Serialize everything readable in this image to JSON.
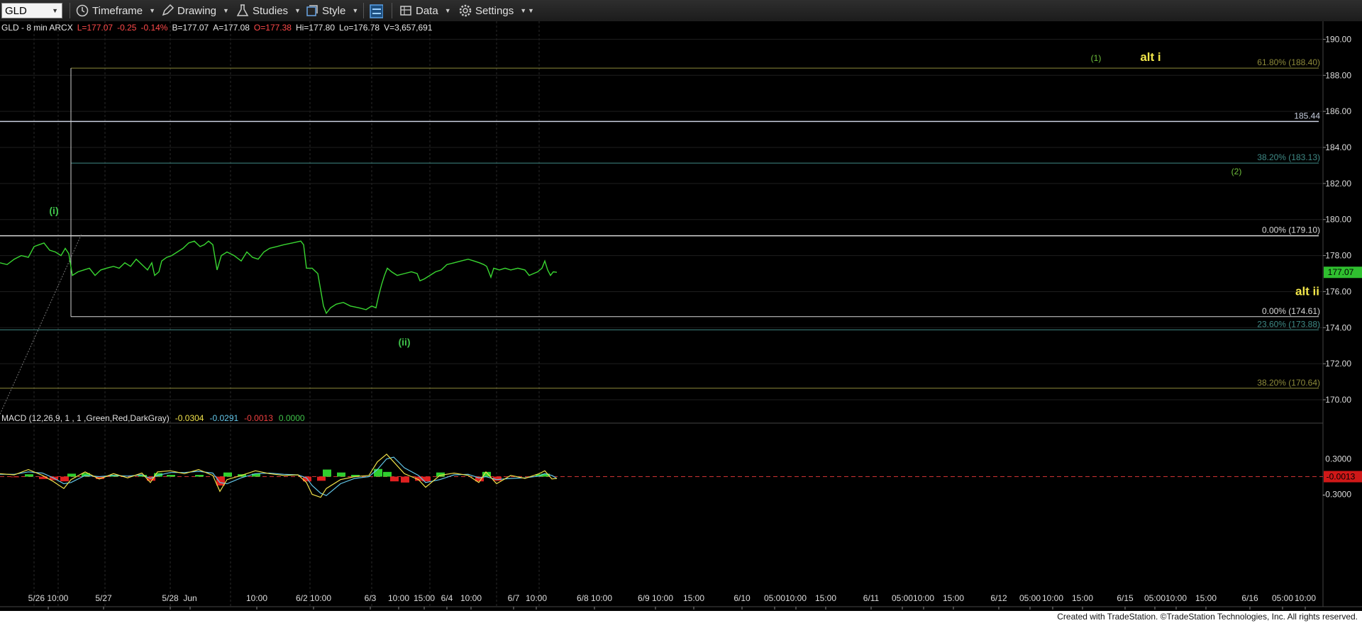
{
  "toolbar": {
    "symbol": "GLD",
    "items": [
      {
        "label": "Timeframe",
        "icon": "clock-icon"
      },
      {
        "label": "Drawing",
        "icon": "pencil-icon"
      },
      {
        "label": "Studies",
        "icon": "flask-icon"
      },
      {
        "label": "Style",
        "icon": "style-icon"
      },
      {
        "label": "",
        "icon": "layout-icon"
      },
      {
        "label": "Data",
        "icon": "data-table-icon"
      },
      {
        "label": "Settings",
        "icon": "gear-icon"
      }
    ]
  },
  "header": {
    "symbol_info": "GLD - 8 min  ARCX",
    "last": "L=177.07",
    "change": "-0.25",
    "pct_change": "-0.14%",
    "bid": "B=177.07",
    "ask": "A=177.08",
    "open": "O=177.38",
    "high": "Hi=177.80",
    "low": "Lo=176.78",
    "volume": "V=3,657,691"
  },
  "chart_data": {
    "type": "line",
    "price_axis": {
      "ticks": [
        "190.00",
        "188.00",
        "186.00",
        "184.00",
        "182.00",
        "180.00",
        "178.00",
        "176.00",
        "174.00",
        "172.00",
        "170.00"
      ],
      "range": [
        168.9,
        191.0
      ]
    },
    "last_price_tag": "177.07",
    "horizontal_levels": [
      {
        "price": 188.4,
        "label": "61.80% (188.40)",
        "color": "#8d8a3a"
      },
      {
        "price": 185.44,
        "label": "185.44",
        "color": "#c9d0e0"
      },
      {
        "price": 183.13,
        "label": "38.20% (183.13)",
        "color": "#3f8a86"
      },
      {
        "price": 179.1,
        "label": "0.00% (179.10)",
        "color": "#d8d8d8"
      },
      {
        "price": 174.61,
        "label": "0.00% (174.61)",
        "color": "#d8d8d8"
      },
      {
        "price": 173.88,
        "label": "23.60% (173.88)",
        "color": "#3f8a86"
      },
      {
        "price": 170.64,
        "label": "38.20% (170.64)",
        "color": "#8d8a3a"
      }
    ],
    "wave_labels": [
      {
        "text": "(i)",
        "color": "#3fc24a"
      },
      {
        "text": "(ii)",
        "color": "#3fc24a"
      },
      {
        "text": "(1)",
        "color": "#6fc03c"
      },
      {
        "text": "(2)",
        "color": "#6fc03c"
      },
      {
        "text": "alt i",
        "color": "#f2e64a"
      },
      {
        "text": "alt ii",
        "color": "#f2e64a"
      }
    ],
    "time_axis": [
      "5/26 10:00",
      "5/27",
      "5/28",
      "Jun",
      "10:00",
      "6/2 10:00",
      "6/3",
      "10:00",
      "15:00",
      "6/4",
      "10:00",
      "6/7",
      "10:00",
      "6/8 10:00",
      "6/9 10:00",
      "15:00",
      "6/10",
      "05:00",
      "10:00",
      "15:00",
      "6/11",
      "05:00",
      "10:00",
      "15:00",
      "6/12",
      "05:00",
      "10:00",
      "15:00",
      "6/15",
      "05:00",
      "10:00",
      "15:00",
      "6/16",
      "05:00",
      "10:00"
    ],
    "price_series": [
      [
        0,
        177.6
      ],
      [
        10,
        177.5
      ],
      [
        20,
        177.8
      ],
      [
        30,
        178.0
      ],
      [
        40,
        177.9
      ],
      [
        48,
        178.5
      ],
      [
        55,
        178.6
      ],
      [
        62,
        178.7
      ],
      [
        70,
        178.3
      ],
      [
        78,
        178.2
      ],
      [
        86,
        178.0
      ],
      [
        92,
        178.4
      ],
      [
        97,
        178.1
      ],
      [
        102,
        176.9
      ],
      [
        110,
        177.1
      ],
      [
        118,
        177.2
      ],
      [
        126,
        177.3
      ],
      [
        134,
        176.9
      ],
      [
        142,
        177.2
      ],
      [
        150,
        177.3
      ],
      [
        160,
        177.4
      ],
      [
        168,
        177.3
      ],
      [
        176,
        177.6
      ],
      [
        184,
        177.4
      ],
      [
        192,
        177.8
      ],
      [
        200,
        177.5
      ],
      [
        208,
        177.2
      ],
      [
        214,
        177.6
      ],
      [
        218,
        176.9
      ],
      [
        224,
        177.1
      ],
      [
        228,
        177.7
      ],
      [
        235,
        177.9
      ],
      [
        242,
        178.0
      ],
      [
        250,
        178.2
      ],
      [
        258,
        178.4
      ],
      [
        266,
        178.7
      ],
      [
        274,
        178.8
      ],
      [
        282,
        178.5
      ],
      [
        288,
        178.6
      ],
      [
        294,
        178.8
      ],
      [
        300,
        178.6
      ],
      [
        306,
        177.2
      ],
      [
        312,
        178.0
      ],
      [
        320,
        178.2
      ],
      [
        330,
        178.0
      ],
      [
        340,
        177.7
      ],
      [
        348,
        178.2
      ],
      [
        356,
        177.9
      ],
      [
        364,
        177.8
      ],
      [
        372,
        178.2
      ],
      [
        380,
        178.4
      ],
      [
        390,
        178.5
      ],
      [
        400,
        178.6
      ],
      [
        412,
        178.7
      ],
      [
        424,
        178.8
      ],
      [
        428,
        178.6
      ],
      [
        432,
        177.3
      ],
      [
        440,
        177.3
      ],
      [
        448,
        177.0
      ],
      [
        452,
        176.1
      ],
      [
        456,
        175.2
      ],
      [
        460,
        174.8
      ],
      [
        466,
        175.1
      ],
      [
        474,
        175.3
      ],
      [
        484,
        175.4
      ],
      [
        494,
        175.2
      ],
      [
        506,
        175.1
      ],
      [
        516,
        175.0
      ],
      [
        524,
        175.2
      ],
      [
        530,
        175.1
      ],
      [
        534,
        175.8
      ],
      [
        538,
        176.4
      ],
      [
        542,
        176.9
      ],
      [
        546,
        177.3
      ],
      [
        552,
        177.1
      ],
      [
        560,
        176.9
      ],
      [
        570,
        177.0
      ],
      [
        580,
        177.1
      ],
      [
        588,
        177.0
      ],
      [
        592,
        176.6
      ],
      [
        598,
        176.7
      ],
      [
        606,
        176.9
      ],
      [
        614,
        177.1
      ],
      [
        622,
        177.2
      ],
      [
        630,
        177.5
      ],
      [
        640,
        177.6
      ],
      [
        650,
        177.7
      ],
      [
        660,
        177.8
      ],
      [
        668,
        177.7
      ],
      [
        676,
        177.6
      ],
      [
        682,
        177.5
      ],
      [
        686,
        177.4
      ],
      [
        692,
        176.8
      ],
      [
        696,
        177.3
      ],
      [
        704,
        177.2
      ],
      [
        712,
        177.3
      ],
      [
        720,
        177.2
      ],
      [
        730,
        177.3
      ],
      [
        740,
        177.2
      ],
      [
        746,
        176.9
      ],
      [
        752,
        177.0
      ],
      [
        758,
        177.1
      ],
      [
        764,
        177.3
      ],
      [
        768,
        177.7
      ],
      [
        772,
        177.2
      ],
      [
        776,
        176.9
      ],
      [
        780,
        177.1
      ],
      [
        785,
        177.07
      ]
    ],
    "macd": {
      "label": "MACD (12,26,9, 1 , 1 ,Green,Red,DarkGray)",
      "values": [
        "-0.0304",
        "-0.0291",
        "-0.0013",
        "0.0000"
      ],
      "value_colors": [
        "#f0e14a",
        "#63c7ea",
        "#f04040",
        "#3fc24a"
      ],
      "axis_ticks": [
        "0.3000",
        "-0.3000"
      ],
      "last_tag": "-0.0013",
      "range": [
        -0.45,
        0.45
      ],
      "macd_line": [
        [
          0,
          0.05
        ],
        [
          20,
          0.03
        ],
        [
          40,
          0.12
        ],
        [
          60,
          0.02
        ],
        [
          75,
          -0.08
        ],
        [
          90,
          -0.2
        ],
        [
          100,
          -0.05
        ],
        [
          120,
          0.08
        ],
        [
          140,
          -0.04
        ],
        [
          160,
          0.05
        ],
        [
          180,
          -0.02
        ],
        [
          200,
          0.06
        ],
        [
          212,
          -0.1
        ],
        [
          222,
          0.08
        ],
        [
          240,
          0.1
        ],
        [
          260,
          0.05
        ],
        [
          280,
          0.12
        ],
        [
          300,
          0.02
        ],
        [
          310,
          -0.25
        ],
        [
          320,
          -0.05
        ],
        [
          340,
          0.02
        ],
        [
          360,
          0.1
        ],
        [
          380,
          0.05
        ],
        [
          400,
          0.02
        ],
        [
          420,
          0.03
        ],
        [
          432,
          -0.1
        ],
        [
          440,
          -0.3
        ],
        [
          452,
          -0.35
        ],
        [
          460,
          -0.2
        ],
        [
          480,
          -0.05
        ],
        [
          500,
          0.0
        ],
        [
          520,
          0.02
        ],
        [
          532,
          0.25
        ],
        [
          545,
          0.38
        ],
        [
          555,
          0.25
        ],
        [
          570,
          0.05
        ],
        [
          590,
          -0.05
        ],
        [
          600,
          -0.18
        ],
        [
          620,
          0.02
        ],
        [
          640,
          0.06
        ],
        [
          660,
          0.02
        ],
        [
          675,
          -0.1
        ],
        [
          685,
          0.08
        ],
        [
          700,
          -0.12
        ],
        [
          720,
          0.02
        ],
        [
          740,
          -0.03
        ],
        [
          760,
          0.05
        ],
        [
          768,
          0.1
        ],
        [
          778,
          -0.04
        ],
        [
          785,
          -0.03
        ]
      ],
      "signal_line": [
        [
          0,
          0.04
        ],
        [
          20,
          0.04
        ],
        [
          40,
          0.08
        ],
        [
          60,
          0.06
        ],
        [
          75,
          -0.02
        ],
        [
          90,
          -0.12
        ],
        [
          100,
          -0.1
        ],
        [
          120,
          0.02
        ],
        [
          140,
          0.0
        ],
        [
          160,
          0.02
        ],
        [
          180,
          0.01
        ],
        [
          200,
          0.03
        ],
        [
          212,
          -0.03
        ],
        [
          222,
          0.02
        ],
        [
          240,
          0.07
        ],
        [
          260,
          0.07
        ],
        [
          280,
          0.09
        ],
        [
          300,
          0.06
        ],
        [
          310,
          -0.1
        ],
        [
          320,
          -0.12
        ],
        [
          340,
          -0.02
        ],
        [
          360,
          0.05
        ],
        [
          380,
          0.06
        ],
        [
          400,
          0.04
        ],
        [
          420,
          0.03
        ],
        [
          432,
          -0.02
        ],
        [
          440,
          -0.15
        ],
        [
          452,
          -0.28
        ],
        [
          460,
          -0.32
        ],
        [
          480,
          -0.12
        ],
        [
          500,
          -0.03
        ],
        [
          520,
          0.0
        ],
        [
          532,
          0.12
        ],
        [
          545,
          0.3
        ],
        [
          555,
          0.33
        ],
        [
          570,
          0.15
        ],
        [
          590,
          0.02
        ],
        [
          600,
          -0.1
        ],
        [
          620,
          -0.05
        ],
        [
          640,
          0.03
        ],
        [
          660,
          0.04
        ],
        [
          675,
          -0.02
        ],
        [
          685,
          0.0
        ],
        [
          700,
          -0.05
        ],
        [
          720,
          -0.03
        ],
        [
          740,
          -0.02
        ],
        [
          760,
          0.01
        ],
        [
          768,
          0.05
        ],
        [
          778,
          0.02
        ],
        [
          785,
          -0.03
        ]
      ],
      "histogram": [
        [
          20,
          -0.01
        ],
        [
          40,
          0.04
        ],
        [
          60,
          -0.04
        ],
        [
          75,
          -0.06
        ],
        [
          90,
          -0.08
        ],
        [
          100,
          0.05
        ],
        [
          120,
          0.06
        ],
        [
          140,
          -0.04
        ],
        [
          160,
          0.03
        ],
        [
          200,
          0.03
        ],
        [
          212,
          -0.07
        ],
        [
          222,
          0.06
        ],
        [
          240,
          0.03
        ],
        [
          280,
          0.03
        ],
        [
          310,
          -0.15
        ],
        [
          320,
          0.07
        ],
        [
          340,
          0.04
        ],
        [
          360,
          0.05
        ],
        [
          432,
          -0.08
        ],
        [
          452,
          -0.07
        ],
        [
          460,
          0.12
        ],
        [
          480,
          0.07
        ],
        [
          500,
          0.03
        ],
        [
          532,
          0.13
        ],
        [
          545,
          0.08
        ],
        [
          555,
          -0.08
        ],
        [
          570,
          -0.1
        ],
        [
          590,
          -0.07
        ],
        [
          600,
          -0.08
        ],
        [
          620,
          0.07
        ],
        [
          675,
          -0.08
        ],
        [
          685,
          0.08
        ],
        [
          700,
          -0.07
        ],
        [
          760,
          0.04
        ],
        [
          768,
          0.05
        ]
      ]
    }
  },
  "footer": {
    "credit": "Created with TradeStation. ©TradeStation Technologies, Inc. All rights reserved."
  }
}
